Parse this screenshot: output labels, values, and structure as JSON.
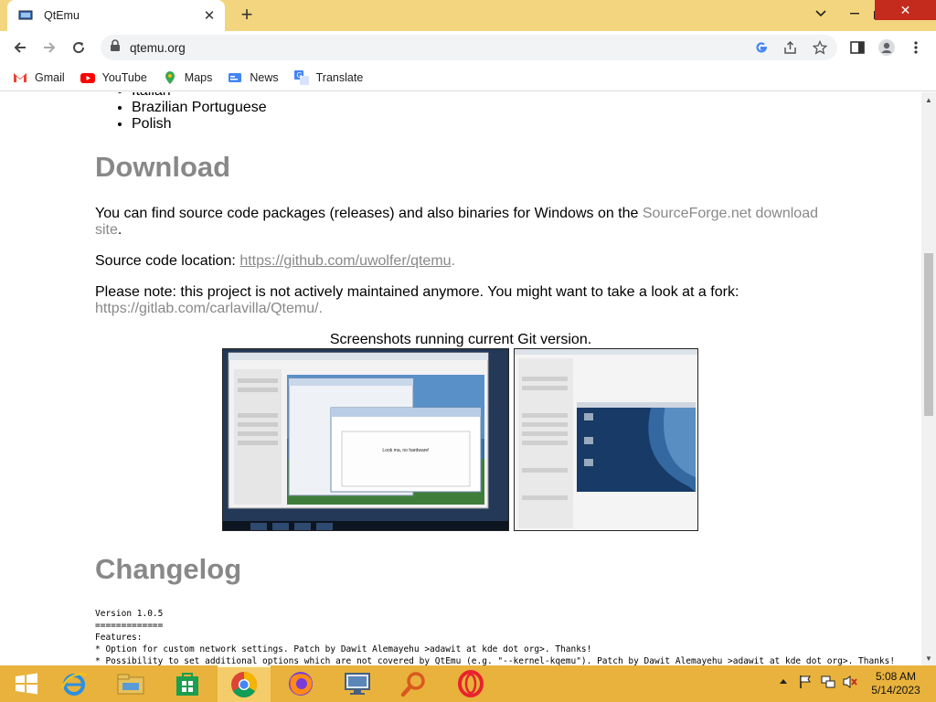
{
  "browser": {
    "tab_title": "QtEmu",
    "new_tab_symbol": "+",
    "url": "qtemu.org",
    "bookmarks": [
      {
        "label": "Gmail",
        "icon": "gmail-icon"
      },
      {
        "label": "YouTube",
        "icon": "youtube-icon"
      },
      {
        "label": "Maps",
        "icon": "maps-icon"
      },
      {
        "label": "News",
        "icon": "news-icon"
      },
      {
        "label": "Translate",
        "icon": "translate-icon"
      }
    ]
  },
  "page": {
    "partial_item": "Italian",
    "languages": [
      "Brazilian Portuguese",
      "Polish"
    ],
    "download_heading": "Download",
    "download_text": "You can find source code packages (releases) and also binaries for Windows on the ",
    "download_link": "SourceForge.net download site",
    "download_end": ".",
    "source_label": "Source code location: ",
    "source_link": "https://github.com/uwolfer/qtemu",
    "source_end": ".",
    "note_text": "Please note: this project is not actively maintained anymore. You might want to take a look at a fork: ",
    "note_link": "https://gitlab.com/carlavilla/Qtemu/",
    "note_end": ".",
    "screenshots_caption": "Screenshots running current Git version.",
    "screenshot1_dialog_text": "Look ma, no hardware!",
    "changelog_heading": "Changelog",
    "changelog_lines": [
      "Version 1.0.5",
      "=============",
      "Features:",
      "* Option for custom network settings. Patch by Dawit Alemayehu >adawit at kde dot org>. Thanks!",
      "* Possibility to set additional options which are not covered by QtEmu (e.g. \"--kernel-kqemu\"). Patch by Dawit Alemayehu >adawit at kde dot org>. Thanks!"
    ]
  },
  "taskbar": {
    "apps": [
      "start-button",
      "internet-explorer",
      "file-explorer",
      "windows-store",
      "chrome",
      "firefox",
      "remote-desktop",
      "search-app",
      "opera"
    ],
    "active_app": "chrome",
    "time": "5:08 AM",
    "date": "5/14/2023"
  },
  "colors": {
    "titlebar": "#f2d57e",
    "taskbar": "#e8b23c",
    "heading_gray": "#888888",
    "close_red": "#c42b1c"
  }
}
